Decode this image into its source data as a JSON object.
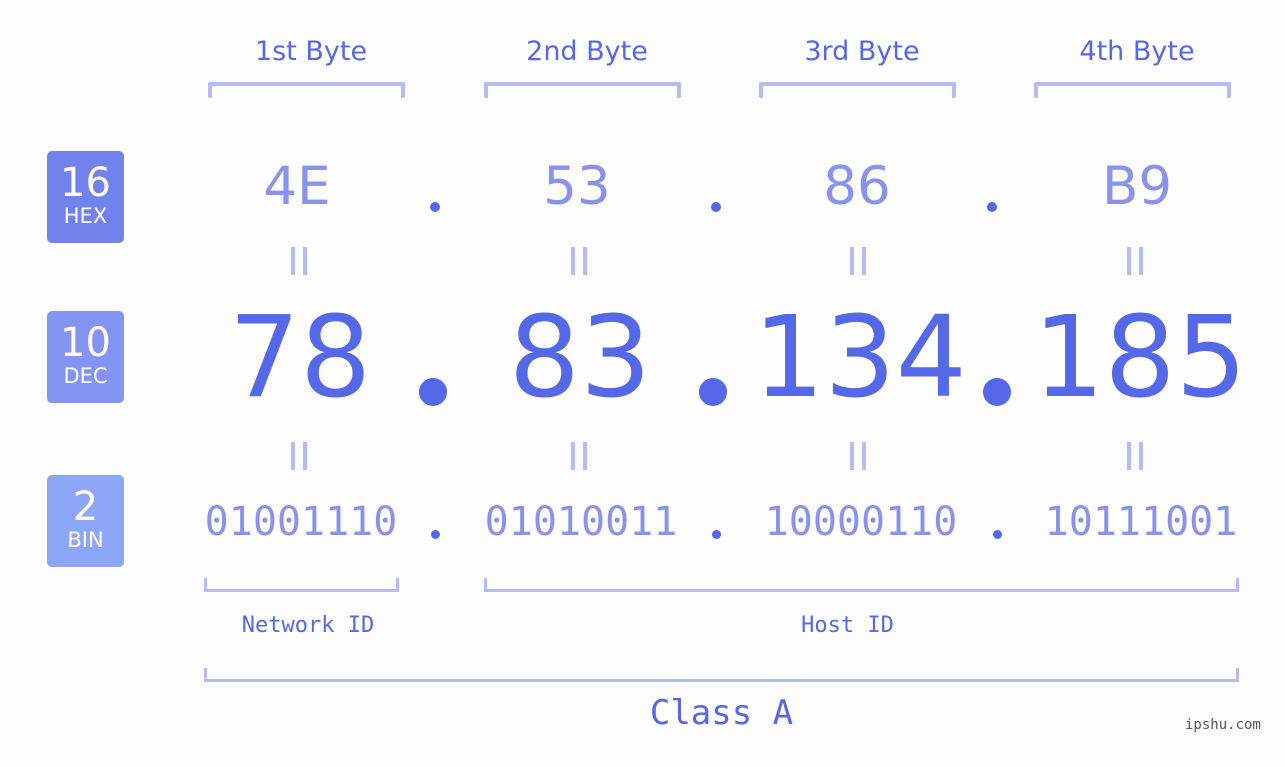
{
  "bytes": [
    {
      "title": "1st Byte",
      "hex": "4E",
      "dec": "78",
      "bin": "01001110"
    },
    {
      "title": "2nd Byte",
      "hex": "53",
      "dec": "83",
      "bin": "01010011"
    },
    {
      "title": "3rd Byte",
      "hex": "86",
      "dec": "134",
      "bin": "10000110"
    },
    {
      "title": "4th Byte",
      "hex": "B9",
      "dec": "185",
      "bin": "10111001"
    }
  ],
  "badges": {
    "hex": {
      "num": "16",
      "label": "HEX",
      "color": "#7282ec"
    },
    "dec": {
      "num": "10",
      "label": "DEC",
      "color": "#8494f2"
    },
    "bin": {
      "num": "2",
      "label": "BIN",
      "color": "#8ea6f8"
    }
  },
  "labels": {
    "network_id": "Network ID",
    "host_id": "Host ID",
    "class": "Class A"
  },
  "watermark": "ipshu.com",
  "colors": {
    "accent": "#5468e8",
    "light": "#8893ef",
    "bracket": "#b3bcf7"
  }
}
